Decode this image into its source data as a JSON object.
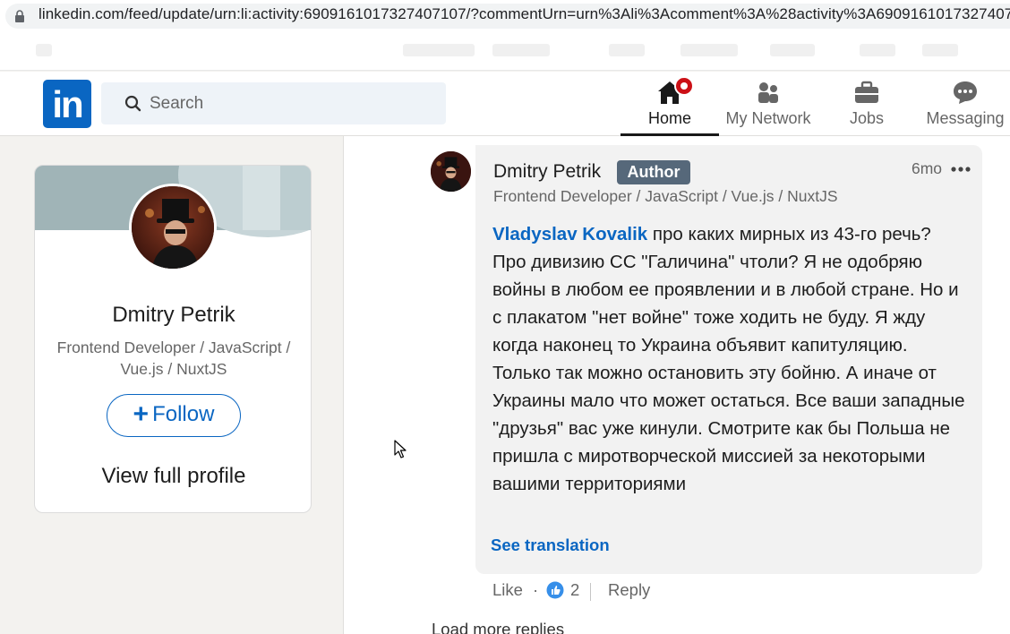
{
  "browser": {
    "url": "linkedin.com/feed/update/urn:li:activity:6909161017327407107/?commentUrn=urn%3Ali%3Acomment%3A%28activity%3A6909161017327407"
  },
  "nav": {
    "search_placeholder": "Search",
    "items": [
      {
        "label": "Home"
      },
      {
        "label": "My Network"
      },
      {
        "label": "Jobs"
      },
      {
        "label": "Messaging"
      }
    ]
  },
  "profile_card": {
    "name": "Dmitry Petrik",
    "headline": "Frontend Developer / JavaScript / Vue.js / NuxtJS",
    "follow_label": "Follow",
    "follow_icon": "+",
    "view_profile_label": "View full profile"
  },
  "comment": {
    "author": "Dmitry Petrik",
    "author_badge": "Author",
    "time": "6mo",
    "headline": "Frontend Developer / JavaScript / Vue.js / NuxtJS",
    "mention": "Vladyslav Kovalik",
    "text": " про каких мирных из 43-го речь? Про дивизию СС \"Галичина\" чтоли? Я не одобряю войны в любом ее проявлении и в любой стране. Но и с плакатом \"нет войне\" тоже ходить не буду. Я жду когда наконец то Украина объявит капитуляцию. Только так можно остановить эту бойню. А иначе от Украины мало что может остаться. Все ваши западные \"друзья\" вас уже кинули. Смотрите как бы Польша не пришла с миротворческой миссией за некоторыми вашими территориями",
    "see_translation": "See translation",
    "like_label": "Like",
    "separator_dot": "·",
    "reaction_count": "2",
    "reply_label": "Reply"
  },
  "load_more": "Load more replies",
  "colors": {
    "brand": "#0a66c2",
    "notification": "#cc1016",
    "author_badge": "#56687a"
  }
}
